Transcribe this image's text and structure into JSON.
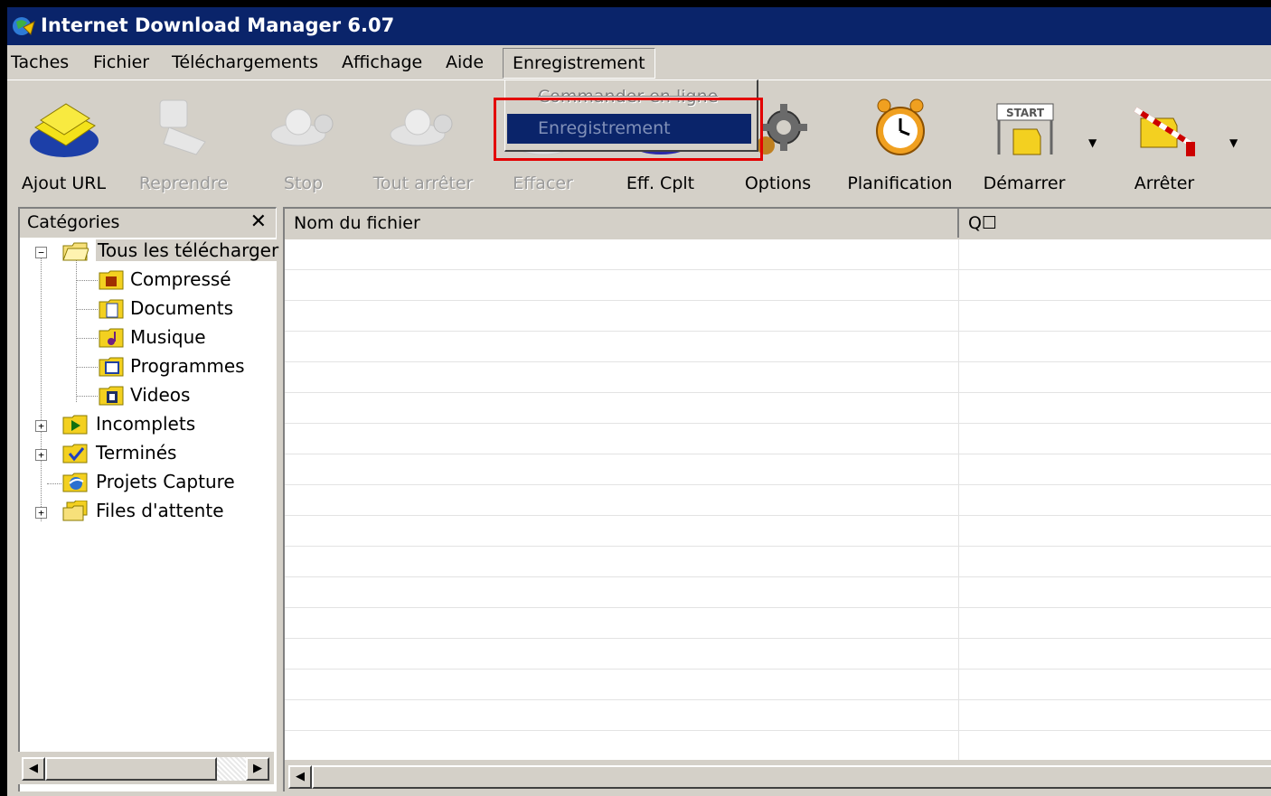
{
  "window": {
    "title": "Internet Download Manager 6.07"
  },
  "menubar": [
    {
      "label": "Taches"
    },
    {
      "label": "Fichier"
    },
    {
      "label": "Téléchargements"
    },
    {
      "label": "Affichage"
    },
    {
      "label": "Aide"
    },
    {
      "label": "Enregistrement",
      "open": true
    }
  ],
  "dropdown": {
    "items": [
      {
        "label": "Commander en ligne",
        "state": "disabled"
      },
      {
        "label": "Enregistrement",
        "state": "disabled-highlighted"
      }
    ]
  },
  "toolbar": {
    "buttons": [
      {
        "label": "Ajout URL",
        "icon": "add-url-icon",
        "enabled": true
      },
      {
        "label": "Reprendre",
        "icon": "resume-icon",
        "enabled": false
      },
      {
        "label": "Stop",
        "icon": "stop-icon",
        "enabled": false
      },
      {
        "label": "Tout arrêter",
        "icon": "stop-all-icon",
        "enabled": false
      },
      {
        "label": "Effacer",
        "icon": "delete-icon",
        "enabled": false
      },
      {
        "label": "Eff. Cplt",
        "icon": "delete-completed-icon",
        "enabled": true
      },
      {
        "label": "Options",
        "icon": "options-gear-icon",
        "enabled": true
      },
      {
        "label": "Planification",
        "icon": "alarm-clock-icon",
        "enabled": true
      },
      {
        "label": "Démarrer",
        "icon": "start-queue-icon",
        "enabled": true
      },
      {
        "label": "Arrêter",
        "icon": "stop-queue-icon",
        "enabled": true
      }
    ]
  },
  "sidebar": {
    "title": "Catégories",
    "close_glyph": "✕",
    "tree": [
      {
        "label": "Tous les télécharger",
        "icon": "folder-open-icon",
        "level": 0,
        "expander": "−",
        "selected": true
      },
      {
        "label": "Compressé",
        "icon": "folder-archive-icon",
        "level": 1
      },
      {
        "label": "Documents",
        "icon": "folder-document-icon",
        "level": 1
      },
      {
        "label": "Musique",
        "icon": "folder-music-icon",
        "level": 1
      },
      {
        "label": "Programmes",
        "icon": "folder-program-icon",
        "level": 1
      },
      {
        "label": "Videos",
        "icon": "folder-video-icon",
        "level": 1
      },
      {
        "label": "Incomplets",
        "icon": "folder-incomplete-icon",
        "level": 0,
        "expander": "+"
      },
      {
        "label": "Terminés",
        "icon": "folder-finished-icon",
        "level": 0,
        "expander": "+"
      },
      {
        "label": "Projets Capture",
        "icon": "grabber-projects-icon",
        "level": 0
      },
      {
        "label": "Files d'attente",
        "icon": "folder-queues-icon",
        "level": 0,
        "expander": "+"
      }
    ]
  },
  "filelist": {
    "columns": [
      "Nom du fichier",
      "Q☐"
    ],
    "rows": []
  },
  "colors": {
    "titlebar": "#0a246a",
    "face": "#d4d0c8",
    "highlight_box": "#e30000"
  }
}
